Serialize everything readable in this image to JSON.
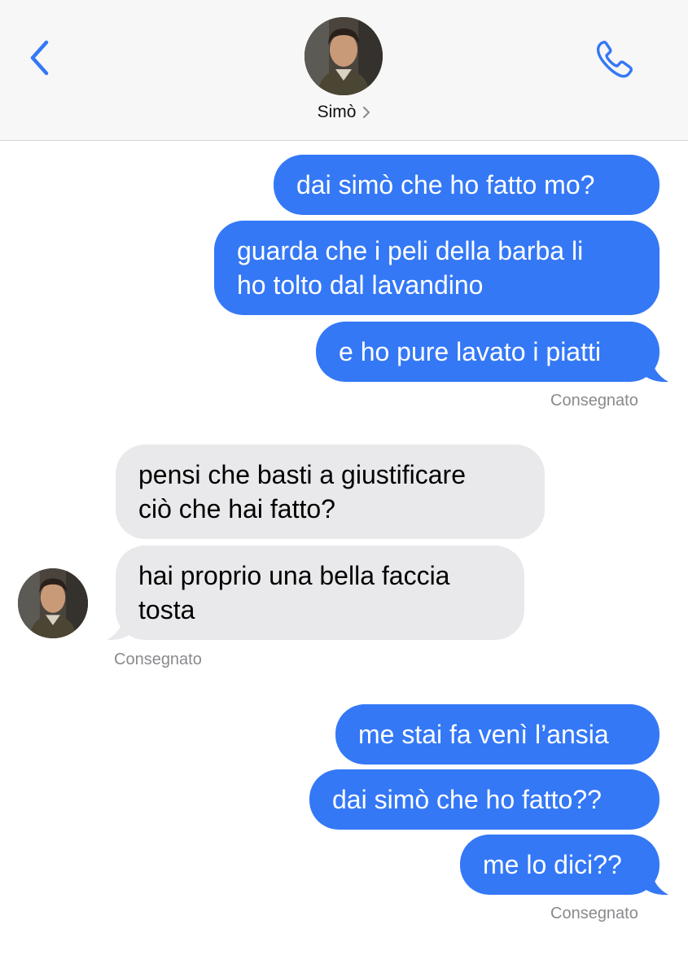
{
  "header": {
    "contact_name": "Simò",
    "back_icon": "chevron-left-icon",
    "call_icon": "phone-icon",
    "accent_color": "#3478f6"
  },
  "messages": [
    {
      "direction": "outgoing",
      "text": "dai simò che ho fatto mo?"
    },
    {
      "direction": "outgoing",
      "line1": "guarda che i peli della barba li",
      "line2": "ho tolto dal lavandino"
    },
    {
      "direction": "outgoing",
      "text": "e ho pure lavato i piatti"
    },
    {
      "direction": "incoming",
      "line1": "pensi che basti a giustificare",
      "line2": "ciò che hai fatto?"
    },
    {
      "direction": "incoming",
      "line1": "hai proprio una bella faccia",
      "line2": "tosta"
    },
    {
      "direction": "outgoing",
      "text": "me stai fa venì l’ansia"
    },
    {
      "direction": "outgoing",
      "text": "dai simò che ho fatto??"
    },
    {
      "direction": "outgoing",
      "text": "me lo dici??"
    }
  ],
  "status": {
    "delivered_1": "Consegnato",
    "delivered_2": "Consegnato",
    "delivered_3": "Consegnato"
  }
}
